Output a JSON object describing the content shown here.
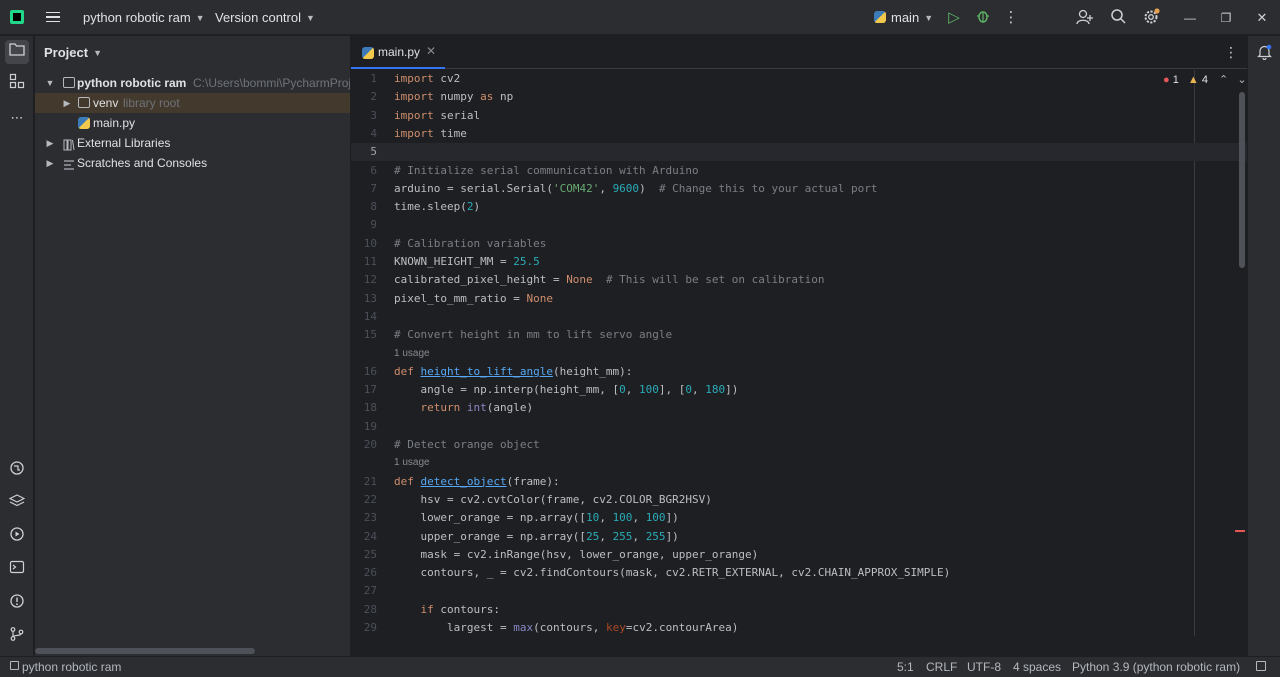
{
  "titlebar": {
    "project_name": "python robotic ram",
    "vcs_menu": "Version control",
    "branch": "main"
  },
  "project_panel": {
    "title": "Project",
    "tree": [
      {
        "name": "python robotic ram",
        "hint": "C:\\Users\\bommi\\PycharmProje",
        "kind": "folder",
        "expanded": true
      },
      {
        "name": "venv",
        "hint": "library root",
        "kind": "folder",
        "expanded": false
      },
      {
        "name": "main.py",
        "hint": "",
        "kind": "python-file"
      },
      {
        "name": "External Libraries",
        "hint": "",
        "kind": "library"
      },
      {
        "name": "Scratches and Consoles",
        "hint": "",
        "kind": "scratches"
      }
    ]
  },
  "editor": {
    "tab_label": "main.py",
    "inspections": {
      "errors": "1",
      "warnings": "4"
    },
    "usage_hint": "1 usage",
    "line_numbers": [
      "1",
      "2",
      "3",
      "4",
      "5",
      "6",
      "7",
      "8",
      "9",
      "10",
      "11",
      "12",
      "13",
      "14",
      "15",
      "16",
      "17",
      "18",
      "19",
      "20",
      "21",
      "22",
      "23",
      "24",
      "25",
      "26",
      "27",
      "28",
      "29"
    ],
    "raw_lines": [
      "import cv2",
      "import numpy as np",
      "import serial",
      "import time",
      "",
      "# Initialize serial communication with Arduino",
      "arduino = serial.Serial('COM42', 9600)  # Change this to your actual port",
      "time.sleep(2)",
      "",
      "# Calibration variables",
      "KNOWN_HEIGHT_MM = 25.5",
      "calibrated_pixel_height = None  # This will be set on calibration",
      "pixel_to_mm_ratio = None",
      "",
      "# Convert height in mm to lift servo angle",
      "def height_to_lift_angle(height_mm):",
      "    angle = np.interp(height_mm, [0, 100], [0, 180])",
      "    return int(angle)",
      "",
      "# Detect orange object",
      "def detect_object(frame):",
      "    hsv = cv2.cvtColor(frame, cv2.COLOR_BGR2HSV)",
      "    lower_orange = np.array([10, 100, 100])",
      "    upper_orange = np.array([25, 255, 255])",
      "    mask = cv2.inRange(hsv, lower_orange, upper_orange)",
      "    contours, _ = cv2.findContours(mask, cv2.RETR_EXTERNAL, cv2.CHAIN_APPROX_SIMPLE)",
      "",
      "    if contours:",
      "        largest = max(contours, key=cv2.contourArea)"
    ],
    "code_lines": [
      [
        {
          "t": "import",
          "c": "kw"
        },
        {
          "t": " cv2"
        }
      ],
      [
        {
          "t": "import",
          "c": "kw"
        },
        {
          "t": " numpy "
        },
        {
          "t": "as",
          "c": "kw"
        },
        {
          "t": " np"
        }
      ],
      [
        {
          "t": "import",
          "c": "kw"
        },
        {
          "t": " serial"
        }
      ],
      [
        {
          "t": "import",
          "c": "kw"
        },
        {
          "t": " time"
        }
      ],
      [],
      [
        {
          "t": "# Initialize serial communication with Arduino",
          "c": "cmt"
        }
      ],
      [
        {
          "t": "arduino = serial.Serial("
        },
        {
          "t": "'COM42'",
          "c": "str"
        },
        {
          "t": ", "
        },
        {
          "t": "9600",
          "c": "num"
        },
        {
          "t": ")  "
        },
        {
          "t": "# Change this to your actual port",
          "c": "cmt"
        }
      ],
      [
        {
          "t": "time.sleep("
        },
        {
          "t": "2",
          "c": "num"
        },
        {
          "t": ")"
        }
      ],
      [],
      [
        {
          "t": "# Calibration variables",
          "c": "cmt"
        }
      ],
      [
        {
          "t": "KNOWN_HEIGHT_MM = "
        },
        {
          "t": "25.5",
          "c": "num"
        }
      ],
      [
        {
          "t": "calibrated_pixel_height = "
        },
        {
          "t": "None",
          "c": "kw"
        },
        {
          "t": "  "
        },
        {
          "t": "# This will be set on calibration",
          "c": "cmt"
        }
      ],
      [
        {
          "t": "pixel_to_mm_ratio = "
        },
        {
          "t": "None",
          "c": "kw"
        }
      ],
      [],
      [
        {
          "t": "# Convert height in mm to lift servo angle",
          "c": "cmt"
        }
      ],
      [
        {
          "t": "def",
          "c": "kw"
        },
        {
          "t": " "
        },
        {
          "t": "height_to_lift_angle",
          "c": "fn"
        },
        {
          "t": "(height_mm):"
        }
      ],
      [
        {
          "t": "    angle = np.interp(height_mm, ["
        },
        {
          "t": "0",
          "c": "num"
        },
        {
          "t": ", "
        },
        {
          "t": "100",
          "c": "num"
        },
        {
          "t": "], ["
        },
        {
          "t": "0",
          "c": "num"
        },
        {
          "t": ", "
        },
        {
          "t": "180",
          "c": "num"
        },
        {
          "t": "])"
        }
      ],
      [
        {
          "t": "    "
        },
        {
          "t": "return",
          "c": "kw"
        },
        {
          "t": " "
        },
        {
          "t": "int",
          "c": "bi"
        },
        {
          "t": "(angle)"
        }
      ],
      [],
      [
        {
          "t": "# Detect orange object",
          "c": "cmt"
        }
      ],
      [
        {
          "t": "def",
          "c": "kw"
        },
        {
          "t": " "
        },
        {
          "t": "detect_object",
          "c": "fn"
        },
        {
          "t": "(frame):"
        }
      ],
      [
        {
          "t": "    hsv = cv2.cvtColor(frame, cv2.COLOR_BGR2HSV)"
        }
      ],
      [
        {
          "t": "    lower_orange = np.array(["
        },
        {
          "t": "10",
          "c": "num"
        },
        {
          "t": ", "
        },
        {
          "t": "100",
          "c": "num"
        },
        {
          "t": ", "
        },
        {
          "t": "100",
          "c": "num"
        },
        {
          "t": "])"
        }
      ],
      [
        {
          "t": "    upper_orange = np.array(["
        },
        {
          "t": "25",
          "c": "num"
        },
        {
          "t": ", "
        },
        {
          "t": "255",
          "c": "num"
        },
        {
          "t": ", "
        },
        {
          "t": "255",
          "c": "num"
        },
        {
          "t": "])"
        }
      ],
      [
        {
          "t": "    mask = cv2.inRange(hsv, lower_orange, upper_orange)"
        }
      ],
      [
        {
          "t": "    contours, _ = cv2.findContours(mask, cv2.RETR_EXTERNAL, cv2.CHAIN_APPROX_SIMPLE)"
        }
      ],
      [],
      [
        {
          "t": "    "
        },
        {
          "t": "if",
          "c": "kw"
        },
        {
          "t": " contours:"
        }
      ],
      [
        {
          "t": "        largest = "
        },
        {
          "t": "max",
          "c": "bi"
        },
        {
          "t": "(contours, "
        },
        {
          "t": "key",
          "c": "param"
        },
        {
          "t": "=cv2.contourArea)"
        }
      ]
    ]
  },
  "statusbar": {
    "project": "python robotic ram",
    "position": "5:1",
    "line_separator": "CRLF",
    "encoding": "UTF-8",
    "indent": "4 spaces",
    "interpreter": "Python 3.9 (python robotic ram)"
  },
  "colors": {
    "background": "#1e1f22",
    "panel": "#2b2d30",
    "accent": "#3574f0",
    "keyword": "#cf8e6d",
    "number": "#2aacb8",
    "string": "#6aab73",
    "comment": "#7a7e85",
    "error": "#e55757",
    "warning": "#e6b450"
  },
  "icons": [
    "main-menu-icon",
    "run-icon",
    "debug-icon",
    "more-icon",
    "add-user-icon",
    "search-icon",
    "settings-icon",
    "minimize-icon",
    "maximize-icon",
    "close-icon",
    "folder-icon",
    "structure-icon",
    "python-console-icon",
    "layers-icon",
    "services-icon",
    "terminal-icon",
    "problems-icon",
    "git-icon",
    "bell-icon"
  ]
}
